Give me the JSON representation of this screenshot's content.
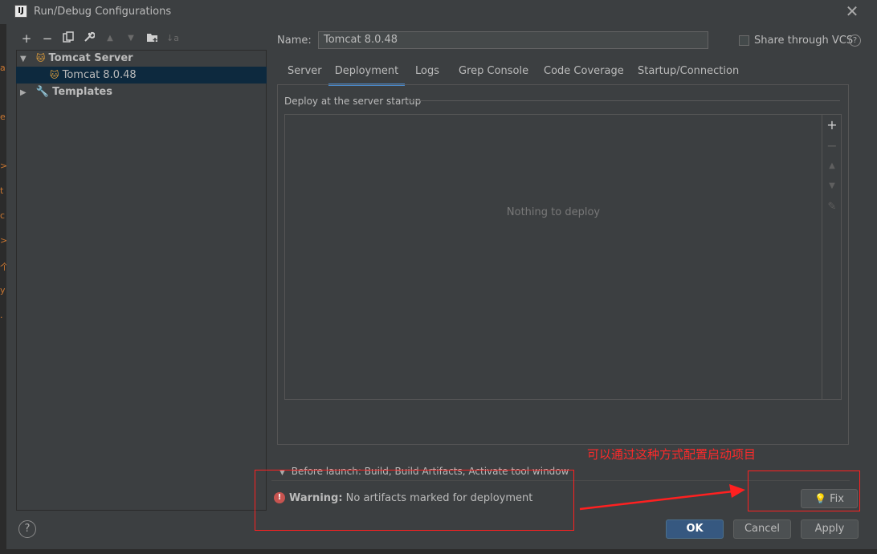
{
  "window": {
    "title": "Run/Debug Configurations",
    "app_icon_text": "IJ",
    "close_label": "✕"
  },
  "toolbar": {
    "add": "+",
    "remove": "−",
    "copy": "⧉",
    "edit": "🔧",
    "move_up": "▲",
    "move_down": "▼",
    "folder": "📁",
    "sort": "↓a"
  },
  "tree": {
    "tomcat_server": "Tomcat Server",
    "tomcat_instance": "Tomcat 8.0.48",
    "templates": "Templates"
  },
  "form": {
    "name_label": "Name:",
    "name_value": "Tomcat 8.0.48",
    "share_label": "Share through VCS",
    "share_checked": false,
    "help": "?"
  },
  "tabs": [
    "Server",
    "Deployment",
    "Logs",
    "Grep Console",
    "Code Coverage",
    "Startup/Connection"
  ],
  "active_tab": "Deployment",
  "deployment": {
    "group_title": "Deploy at the server startup",
    "empty_text": "Nothing to deploy",
    "side_add": "+",
    "side_remove": "−",
    "side_up": "▲",
    "side_down": "▼",
    "side_edit": "✎"
  },
  "before_launch": {
    "arrow": "▼",
    "text": "Before launch: Build, Build Artifacts, Activate tool window"
  },
  "warning": {
    "icon": "!",
    "label": "Warning:",
    "text": " No artifacts marked for deployment"
  },
  "buttons": {
    "fix": "Fix",
    "fix_icon": "💡",
    "ok": "OK",
    "cancel": "Cancel",
    "apply": "Apply",
    "help": "?"
  },
  "annotation": {
    "text": "可以通过这种方式配置启动项目",
    "color": "#ff2a2a"
  },
  "colors": {
    "background": "#3c3f41",
    "selection": "#0d293e",
    "accent": "#4a88c7",
    "warning": "#c75450"
  },
  "edge_glyphs": [
    "a",
    "e",
    ">",
    "t",
    "c",
    ">",
    "个",
    "y",
    "."
  ]
}
